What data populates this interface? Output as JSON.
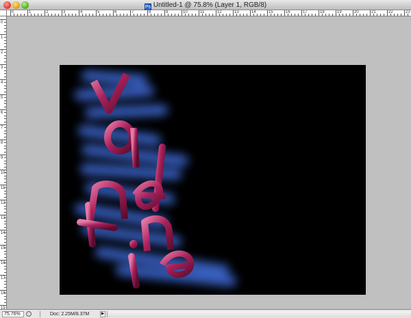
{
  "window": {
    "title": "Untitled-1 @ 75.8% (Layer 1, RGB/8)",
    "doc_icon": "Ps"
  },
  "rulers": {
    "horizontal_numbers": [
      "0",
      "1",
      "2",
      "3",
      "4",
      "5",
      "6",
      "7",
      "8",
      "9",
      "10",
      "11",
      "12",
      "13",
      "14",
      "15",
      "16",
      "17",
      "18",
      "19",
      "20",
      "21",
      "22",
      "23"
    ],
    "vertical_numbers": [
      "0",
      "1",
      "2",
      "3",
      "4",
      "5",
      "6",
      "7",
      "8",
      "9",
      "10",
      "11",
      "12",
      "13",
      "14",
      "15",
      "16",
      "17",
      "18",
      "19"
    ]
  },
  "canvas": {
    "background": "#000000",
    "glow_color": "#3b63c8",
    "letter_color": "#b0245e",
    "artwork_subject": "3D pink letters over blue glow"
  },
  "status": {
    "zoom": "75.76%",
    "doc_info": "Doc: 2.25M/8.37M",
    "menu_arrow": "▶"
  },
  "icons": {
    "close": "red-circle",
    "minimize": "yellow-circle",
    "zoom": "green-circle",
    "doc": "photoshop-document-icon",
    "status": "circle-icon"
  }
}
